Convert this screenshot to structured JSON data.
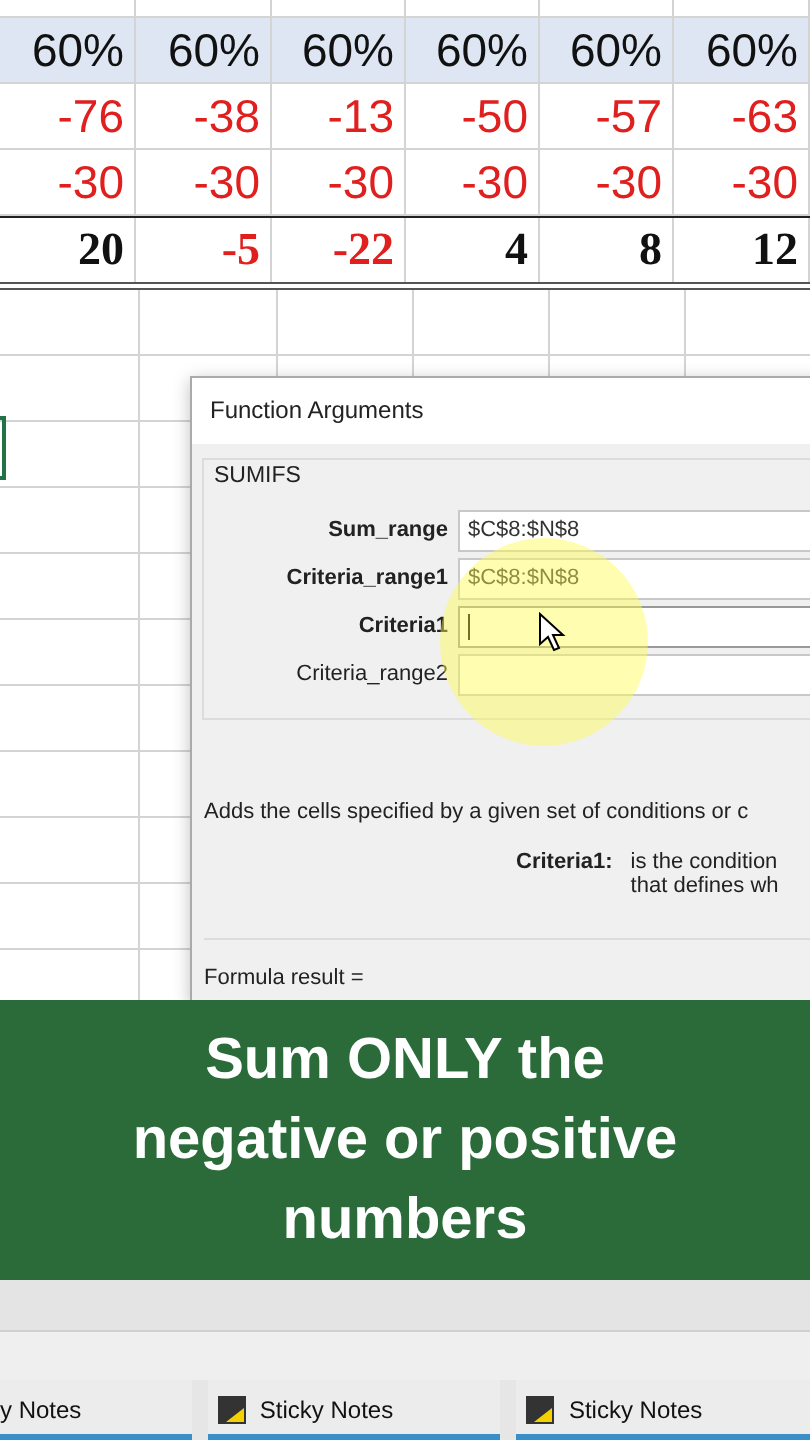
{
  "sheet": {
    "rows": [
      {
        "kind": "header",
        "cells": [
          {
            "text": "60%",
            "negative": false
          },
          {
            "text": "60%",
            "negative": false
          },
          {
            "text": "60%",
            "negative": false
          },
          {
            "text": "60%",
            "negative": false
          },
          {
            "text": "60%",
            "negative": false
          },
          {
            "text": "60%",
            "negative": false
          }
        ]
      },
      {
        "kind": "input",
        "cells": [
          {
            "text": "-76",
            "negative": true
          },
          {
            "text": "-38",
            "negative": true
          },
          {
            "text": "-13",
            "negative": true
          },
          {
            "text": "-50",
            "negative": true
          },
          {
            "text": "-57",
            "negative": true
          },
          {
            "text": "-63",
            "negative": true
          }
        ]
      },
      {
        "kind": "input",
        "cells": [
          {
            "text": "-30",
            "negative": true
          },
          {
            "text": "-30",
            "negative": true
          },
          {
            "text": "-30",
            "negative": true
          },
          {
            "text": "-30",
            "negative": true
          },
          {
            "text": "-30",
            "negative": true
          },
          {
            "text": "-30",
            "negative": true
          }
        ]
      },
      {
        "kind": "total",
        "cells": [
          {
            "text": "20",
            "negative": false
          },
          {
            "text": "-5",
            "negative": true
          },
          {
            "text": "-22",
            "negative": true
          },
          {
            "text": "4",
            "negative": false
          },
          {
            "text": "8",
            "negative": false
          },
          {
            "text": "12",
            "negative": false
          }
        ]
      }
    ]
  },
  "dialog": {
    "title": "Function Arguments",
    "function": "SUMIFS",
    "arguments": [
      {
        "label": "Sum_range",
        "value": "$C$8:$N$8",
        "required": true,
        "focused": false
      },
      {
        "label": "Criteria_range1",
        "value": "$C$8:$N$8",
        "required": true,
        "focused": false
      },
      {
        "label": "Criteria1",
        "required": true,
        "focused": true
      },
      {
        "label": "Criteria_range2",
        "required": false,
        "focused": false
      }
    ],
    "description": "Adds the cells specified by a given set of conditions or c",
    "argument_help": {
      "label": "Criteria1:",
      "lines": [
        "is the condition",
        "that defines wh"
      ]
    },
    "formula_result": "Formula result ="
  },
  "banner": {
    "lines": [
      "Sum ONLY the",
      "negative or positive",
      "numbers"
    ]
  },
  "taskbar": [
    {
      "label": "y Notes",
      "kind": "partial"
    },
    {
      "label": "Sticky Notes",
      "kind": "full"
    },
    {
      "label": "Sticky Notes",
      "kind": "full"
    }
  ]
}
